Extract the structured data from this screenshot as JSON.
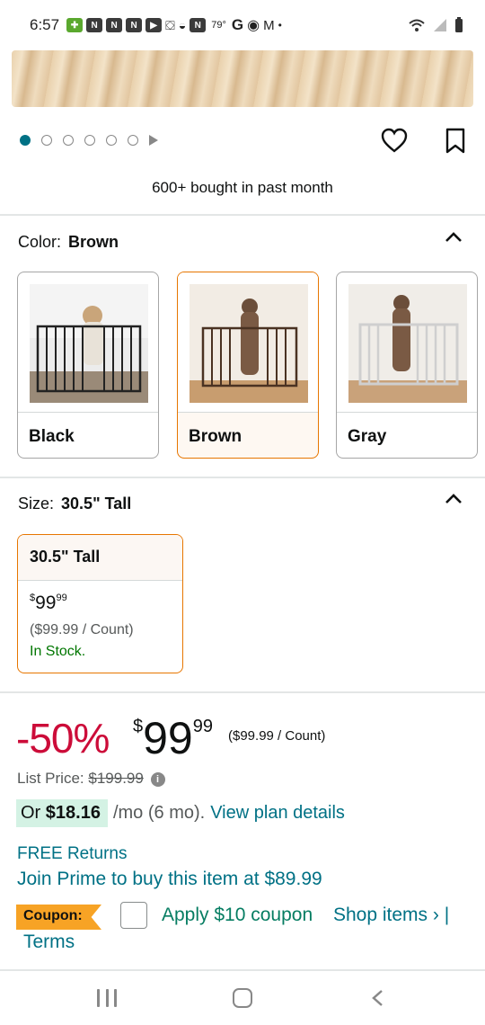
{
  "status_bar": {
    "time": "6:57",
    "temperature": "79°",
    "notif_letter": "N"
  },
  "gallery": {
    "dot_count": 6,
    "active_index": 0
  },
  "bought_text": "600+ bought in past month",
  "color": {
    "label": "Color:",
    "selected": "Brown",
    "options": [
      {
        "name": "Black",
        "selected": false,
        "gate_color": "#2b2b2b"
      },
      {
        "name": "Brown",
        "selected": true,
        "gate_color": "#4a3222"
      },
      {
        "name": "Gray",
        "selected": false,
        "gate_color": "#d6d6d6"
      }
    ]
  },
  "size": {
    "label": "Size:",
    "selected": "30.5\" Tall",
    "card": {
      "title": "30.5\" Tall",
      "price_dollar_sign": "$",
      "price_whole": "99",
      "price_cents": "99",
      "per_unit": "($99.99 / Count)",
      "stock": "In Stock."
    }
  },
  "pricing": {
    "discount": "-50%",
    "currency": "$",
    "whole": "99",
    "cents": "99",
    "per_unit": "($99.99 / Count)",
    "list_label": "List Price:",
    "list_price": "$199.99",
    "plan_or": "Or",
    "plan_amount": "$18.16",
    "plan_term": "/mo (6 mo).",
    "plan_link": "View plan details",
    "free_returns": "FREE Returns",
    "prime_text": "Join Prime to buy this item at $89.99",
    "coupon_label": "Coupon:",
    "coupon_text": "Apply $10 coupon",
    "shop_items": "Shop items › |",
    "terms": "Terms"
  },
  "colors": {
    "link": "#007185",
    "deal_red": "#cc0c39",
    "coupon_green": "#067d62",
    "selected_border": "#e77600"
  }
}
